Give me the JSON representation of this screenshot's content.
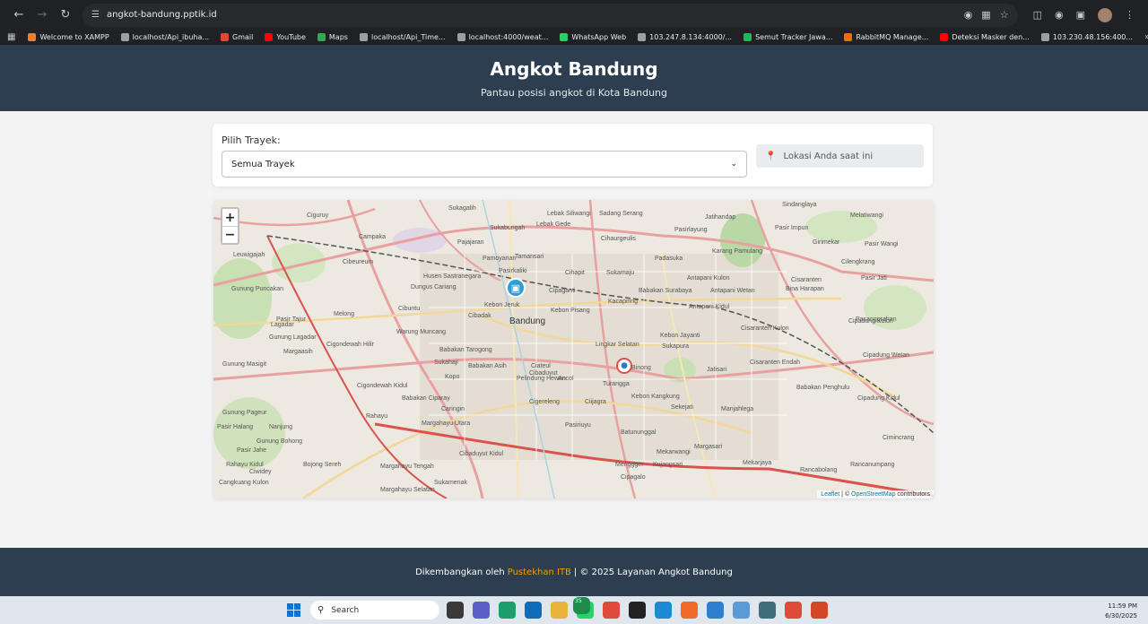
{
  "browser": {
    "url": "angkot-bandung.pptik.id",
    "bookmarks": [
      {
        "label": "Welcome to XAMPP",
        "color": "#fb7a24"
      },
      {
        "label": "localhost/Api_ibuha...",
        "color": "#9aa0a6"
      },
      {
        "label": "Gmail",
        "color": "#ea4335"
      },
      {
        "label": "YouTube",
        "color": "#ff0000"
      },
      {
        "label": "Maps",
        "color": "#34a853"
      },
      {
        "label": "localhost/Api_Time...",
        "color": "#9aa0a6"
      },
      {
        "label": "localhost:4000/weat...",
        "color": "#9aa0a6"
      },
      {
        "label": "WhatsApp Web",
        "color": "#25d366"
      },
      {
        "label": "103.247.8.134:4000/...",
        "color": "#9aa0a6"
      },
      {
        "label": "Semut Tracker Jawa...",
        "color": "#1db954"
      },
      {
        "label": "RabbitMQ Manage...",
        "color": "#ff6600"
      },
      {
        "label": "Deteksi Masker den...",
        "color": "#ff0000"
      },
      {
        "label": "103.230.48.156:400...",
        "color": "#9aa0a6"
      }
    ]
  },
  "header": {
    "title": "Angkot Bandung",
    "subtitle": "Pantau posisi angkot di Kota Bandung"
  },
  "controls": {
    "route_label": "Pilih Trayek:",
    "route_selected": "Semua Trayek",
    "location_text": "Lokasi Anda saat ini"
  },
  "map": {
    "zoom_in": "+",
    "zoom_out": "−",
    "attribution_leaflet": "Leaflet",
    "attribution_sep": " | © ",
    "attribution_osm": "OpenStreetMap",
    "attribution_tail": " contributors",
    "labels": [
      "Sukagalih",
      "Lebak Siliwangi",
      "Sadang Serang",
      "Jatihandap",
      "Sindanglaya",
      "Ciguruy",
      "Campaka",
      "Sukabungah",
      "Lebak Gede",
      "Cihaurgeulis",
      "Pasirlayung",
      "Pasir Impun",
      "Melatiwangi",
      "Pajajaran",
      "Tamansari",
      "Padasuka",
      "Karang Pamulang",
      "Girimekar",
      "Pasir Wangi",
      "Leuwigajah",
      "Cibeureum",
      "Pamoyanan",
      "Pasirkaliki",
      "Cihapit",
      "Sukamaju",
      "Antapani Kulon",
      "Cilengkrang",
      "Husen Sastranegara",
      "Dungus Cariang",
      "Cipaganti",
      "Babakan Surabaya",
      "Antapani Wetan",
      "Cisaranten",
      "Bina Harapan",
      "Pasir Jati",
      "Cibuntu",
      "Kebon Jeruk",
      "Kebon Pisang",
      "Kacapiring",
      "Antapani Kidul",
      "Melong",
      "Cibadak",
      "Bandung",
      "Pasanggrahan",
      "Lagadar",
      "Warung Muncang",
      "Kebon Jayanti",
      "Sukapura",
      "Cipadung Kulon",
      "Cigondewah Hilir",
      "Babakan Tarogong",
      "Lingkar Selatan",
      "Cisaranten Kulon",
      "Margaasih",
      "Sukahaji",
      "Babakan Asih",
      "Pelindung Hewan",
      "Cibaduyut",
      "Jatisari",
      "Cisaranten Endah",
      "Cipadung Wetan",
      "Binong",
      "Kopo",
      "Ciateul",
      "Ancol",
      "Turangga",
      "Cigondewah Kidul",
      "Babakan Ciparay",
      "Kebon Kangkung",
      "Babakan Penghulu",
      "Cipadung Kidul",
      "Caringin",
      "Cigereleng",
      "Ciijagra",
      "Sekejati",
      "Manjahlega",
      "Rahayu",
      "Margahayu Utara",
      "Pasiriuyu",
      "Batununggal",
      "Cimincrang",
      "Nanjung",
      "Margasari",
      "Mekarwangi",
      "Cibaduyut Kidul",
      "Menggger",
      "Kujangsari",
      "Mekarjaya",
      "Rancabolang",
      "Rancanumpang",
      "Margahayu Tengah",
      "Sukamenak",
      "Cipagalo",
      "Margahayu Selatan",
      "Gunung Masigit",
      "Pasir Halang",
      "Gunung Bohong",
      "Gunung Lagadar",
      "Pasir Tajur",
      "Gunung Puncakan",
      "Ciwidey",
      "Pasir Jahe",
      "Bojong Sereh",
      "Cangkuang Kulon",
      "Rahayu Kidul",
      "Gunung Pageur"
    ]
  },
  "footer": {
    "prefix": "Dikembangkan oleh",
    "brand": "Pustekhan ITB",
    "suffix": "| © 2025 Layanan Angkot Bandung"
  },
  "taskbar": {
    "search_placeholder": "Search",
    "time": "11:59 PM",
    "date": "6/30/2025",
    "badge": "35"
  }
}
